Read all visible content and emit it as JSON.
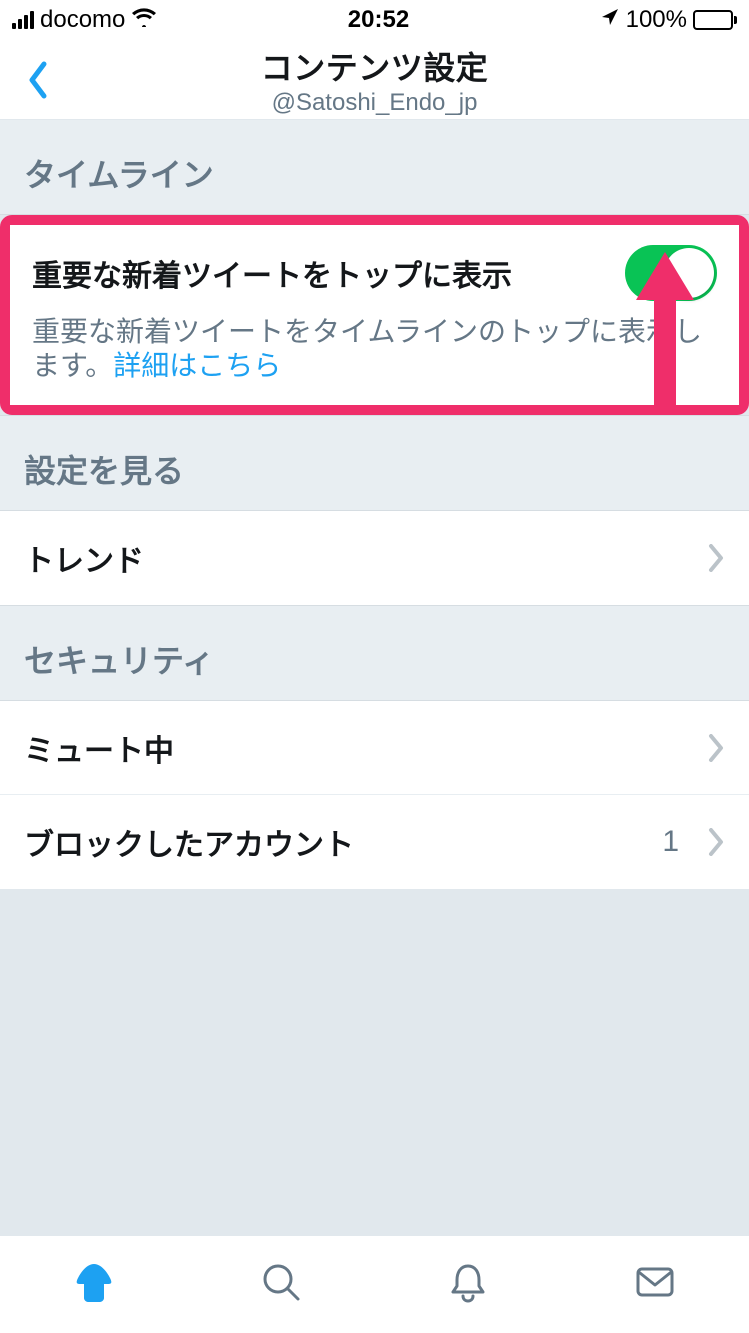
{
  "status_bar": {
    "carrier": "docomo",
    "time": "20:52",
    "battery_pct": "100%"
  },
  "nav": {
    "title": "コンテンツ設定",
    "subtitle": "@Satoshi_Endo_jp"
  },
  "sections": {
    "timeline_header": "タイムライン",
    "settings_header": "設定を見る",
    "security_header": "セキュリティ"
  },
  "toggle": {
    "title": "重要な新着ツイートをトップに表示",
    "description": "重要な新着ツイートをタイムラインのトップに表示します。",
    "link": "詳細はこちら",
    "on": true
  },
  "items": {
    "trends": "トレンド",
    "muted": "ミュート中",
    "blocked": {
      "label": "ブロックしたアカウント",
      "value": "1"
    }
  },
  "colors": {
    "accent": "#1da1f2",
    "highlight": "#ef2e6a",
    "switch_on": "#09c355"
  }
}
